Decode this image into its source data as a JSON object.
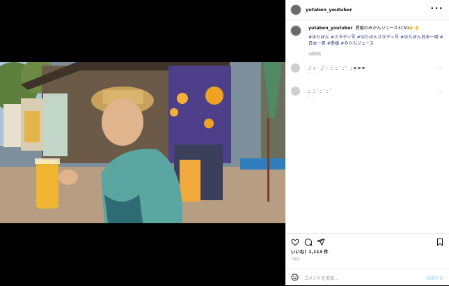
{
  "post": {
    "username": "yutabon_youtuber",
    "caption_user": "yutabon_youtuber",
    "caption_text": "愛媛のみかんジュース3150👉👌",
    "hashtags": "#ゆたぼん #スタディ号 #ゆたぼんスタディ号 #ゆたぼん日本一周 #日本一周 #愛媛 #みかんジュース",
    "caption_time": "1週間前",
    "likes": "いいね！1,113 件",
    "date": "7日前",
    "comment_placeholder": "コメントを追加...",
    "post_button": "投稿する"
  },
  "comments": [
    {
      "text": "ﾆﾟｫｰ ﾆﾟｰ ﾆ ﾆ ﾞﾆ ﾟ ﾆ❤❤❤",
      "sub": "ﾆ ﾆ ﾆ"
    },
    {
      "text": "ﾆ ﾆ ﾞﾆ ﾟﾆ ﾟ",
      "sub": "ﾆ ﾆ"
    }
  ],
  "colors": {
    "accent": "#0095f6",
    "link": "#2f3a7a",
    "border": "#e6e6e6"
  },
  "icons": [
    "more-icon",
    "heart-icon",
    "comment-icon",
    "share-icon",
    "bookmark-icon",
    "emoji-icon"
  ]
}
